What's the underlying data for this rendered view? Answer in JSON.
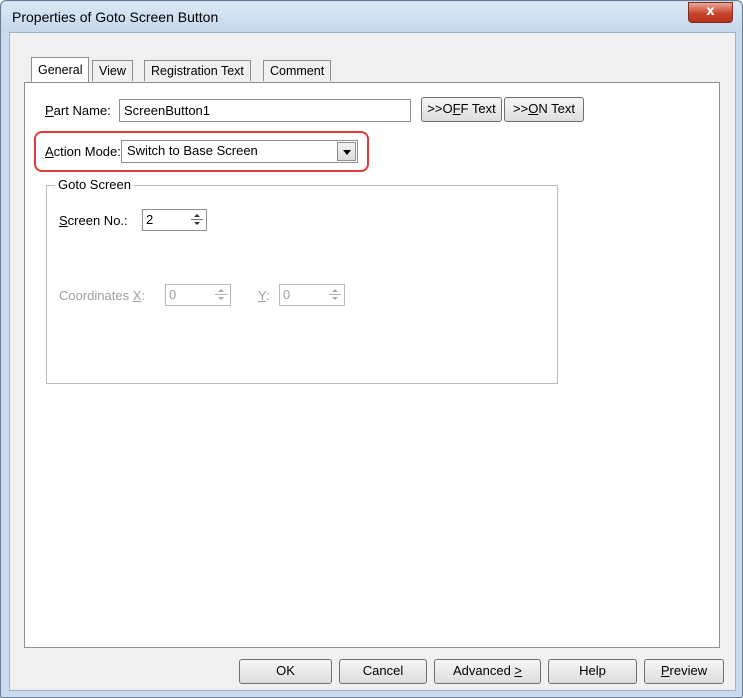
{
  "window": {
    "title": "Properties of Goto Screen Button",
    "close_glyph": "x"
  },
  "tabs": [
    {
      "label": "General",
      "active": true
    },
    {
      "label": "View",
      "active": false
    },
    {
      "label": "Registration Text",
      "active": false
    },
    {
      "label": "Comment",
      "active": false
    }
  ],
  "part_name": {
    "label_key": "P",
    "label_rest": "art Name:",
    "value": "ScreenButton1",
    "off_text_button": {
      "pre": ">>O",
      "key": "F",
      "post": "F Text"
    },
    "on_text_button": {
      "pre": ">>",
      "key": "O",
      "post": "N Text"
    }
  },
  "action_mode": {
    "label_key": "A",
    "label_rest": "ction Mode:",
    "selected": "Switch to Base Screen",
    "highlight_color": "#e03a3a"
  },
  "goto_screen": {
    "group_title": "Goto Screen",
    "screen_no": {
      "label_key": "S",
      "label_rest": "creen No.:",
      "value": "2"
    },
    "coordinates": {
      "label": "Coordinates",
      "x_key": "X",
      "x_suffix": ":",
      "x_value": "0",
      "y_key": "Y",
      "y_suffix": ":",
      "y_value": "0",
      "enabled": false
    }
  },
  "footer_buttons": {
    "ok": "OK",
    "cancel": "Cancel",
    "advanced": {
      "text": "Advanced ",
      "key": ">"
    },
    "help": "Help",
    "preview": {
      "key": "P",
      "rest": "review"
    }
  },
  "colors": {
    "window_frame": "#c9dbee",
    "close_button": "#c7442b",
    "highlight": "#e03a3a"
  },
  "icons": {
    "close": "close-icon",
    "dropdown": "chevron-down-icon",
    "spinner": "spinner-arrows-icon"
  }
}
